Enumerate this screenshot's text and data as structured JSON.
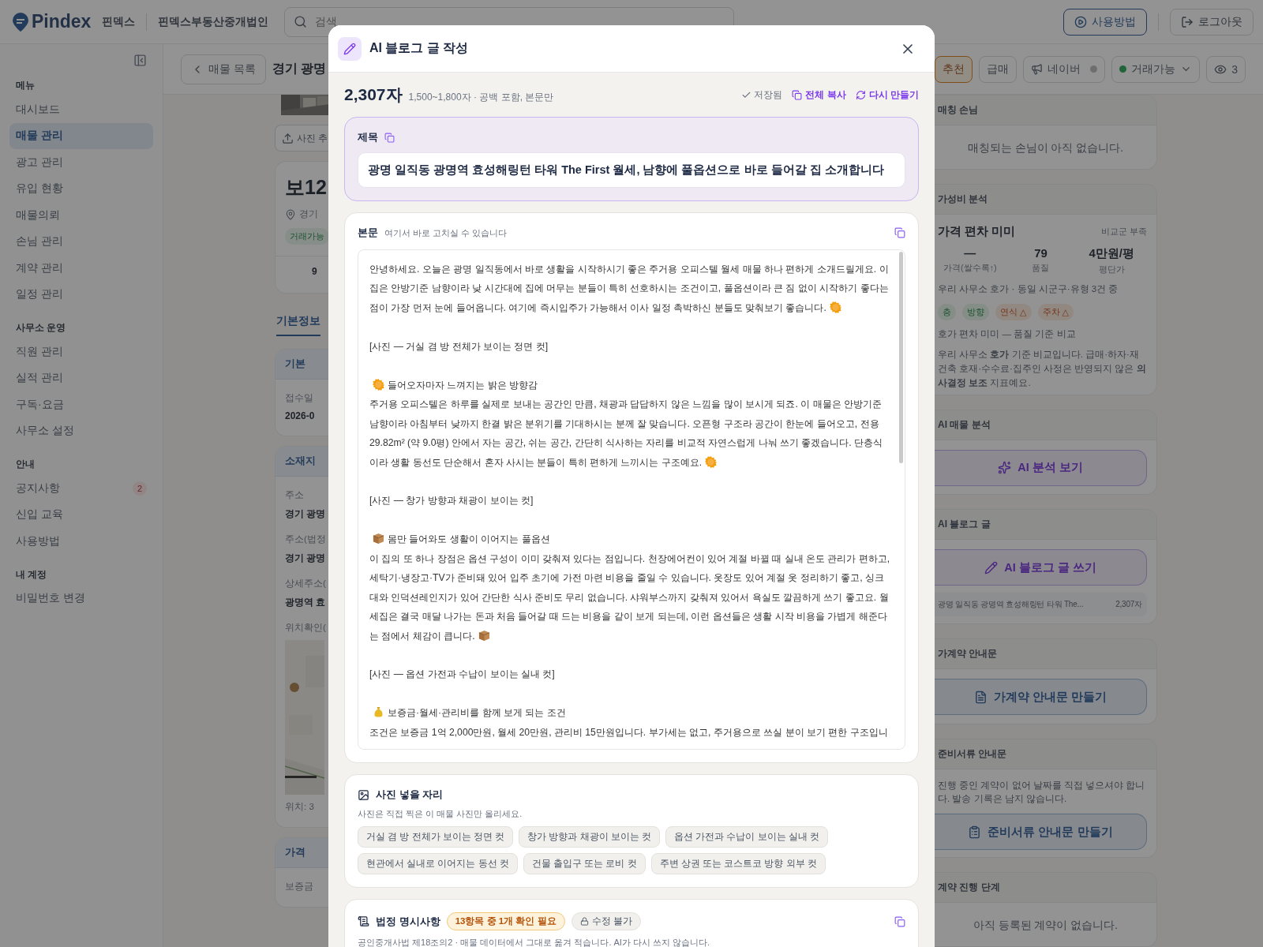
{
  "header": {
    "logo": "Pindex",
    "brand": "핀덱스",
    "office": "핀덱스부동산중개법인",
    "search": {
      "placeholder": "검색"
    },
    "buttons": [
      {
        "kind": "guide",
        "label": "사용방법"
      },
      {
        "kind": "logout",
        "label": "로그아웃"
      }
    ]
  },
  "sidebar": {
    "sections": [
      {
        "title": "메뉴",
        "items": [
          {
            "label": "대시보드",
            "selected": false
          },
          {
            "label": "매물 관리",
            "selected": true
          },
          {
            "label": "광고 관리",
            "selected": false
          },
          {
            "label": "유입 현황",
            "selected": false
          },
          {
            "label": "매물의뢰",
            "selected": false
          },
          {
            "label": "손님 관리",
            "selected": false
          },
          {
            "label": "계약 관리",
            "selected": false
          },
          {
            "label": "일정 관리",
            "selected": false
          }
        ]
      },
      {
        "title": "사무소 운영",
        "items": [
          {
            "label": "직원 관리",
            "selected": false
          },
          {
            "label": "실적 관리",
            "selected": false
          },
          {
            "label": "구독·요금",
            "selected": false
          },
          {
            "label": "사무소 설정",
            "selected": false
          }
        ]
      },
      {
        "title": "안내",
        "items": [
          {
            "label": "공지사항",
            "selected": false,
            "badge": "2"
          },
          {
            "label": "신입 교육",
            "selected": false
          },
          {
            "label": "사용방법",
            "selected": false
          }
        ]
      },
      {
        "title": "내 계정",
        "items": [
          {
            "label": "비밀번호 변경",
            "selected": false
          }
        ]
      }
    ]
  },
  "toolbar": {
    "back": "매물 목록",
    "title": "경기 광명",
    "actions": [
      {
        "kind": "recommend",
        "label": "추천",
        "selected": true
      },
      {
        "kind": "urgent",
        "label": "급매",
        "selected": false
      },
      {
        "kind": "naver",
        "label": "네이버",
        "on": false
      },
      {
        "kind": "status",
        "label": "거래가능"
      },
      {
        "kind": "views",
        "label": "3"
      }
    ]
  },
  "listing": {
    "upload": "사진 추",
    "price": "보12",
    "address": "경기",
    "status": "거래가능",
    "stat": "9",
    "tab": {
      "label": "기본정보",
      "selected": true
    },
    "sections": [
      {
        "title": "기본",
        "fields": [
          {
            "label": "접수일",
            "value": "2026-0"
          }
        ]
      },
      {
        "title": "소재지",
        "fields": [
          {
            "label": "주소",
            "value": "경기 광명"
          },
          {
            "label": "주소(법정",
            "value": "경기 광명"
          },
          {
            "label": "상세주소(",
            "value": "광명역 효"
          },
          {
            "label": "위치확인(",
            "kind": "map",
            "caption": "위치: 3"
          }
        ]
      },
      {
        "title": "가격",
        "fields": [
          {
            "label": "보증금"
          }
        ]
      }
    ]
  },
  "side_panels": [
    {
      "kind": "empty",
      "title": "매칭 손님",
      "message": "매칭되는 손님이 아직 없습니다."
    },
    {
      "kind": "value",
      "title": "가성비 분석",
      "headline": "가격 편차 미미",
      "note": "비교군 부족",
      "stats": [
        {
          "value": "—",
          "label": "가격(쌀수록↑)"
        },
        {
          "value": "79",
          "label": "품질"
        },
        {
          "value": "4만원/평",
          "label": "평단가"
        }
      ],
      "basis": "우리 사무소 호가 · 동일 시군구·유형 3건 중",
      "tags": [
        {
          "label": "층",
          "kind": "good"
        },
        {
          "label": "방향",
          "kind": "good"
        },
        {
          "label": "연식 △",
          "kind": "caution"
        },
        {
          "label": "주차 △",
          "kind": "caution"
        }
      ],
      "summary": "호가 편차 미미 — 품질 기준 비교",
      "disclaimer": "우리 사무소 **호가** 기준 비교입니다. 급매·하자·재건축 호재·수수료·집주인 사정은 반영되지 않은 **의사결정 보조** 지표예요."
    },
    {
      "kind": "ai",
      "title": "AI 매물 분석",
      "button": "AI 분석 보기"
    },
    {
      "kind": "ai",
      "title": "AI 블로그 글",
      "button": "AI 블로그 글 쓰기",
      "draft": {
        "title": "광명 일직동 광명역 효성해링턴 타워 The...",
        "count": "2,307자"
      }
    },
    {
      "kind": "document",
      "title": "가계약 안내문",
      "button": "가계약 안내문 만들기"
    },
    {
      "kind": "document",
      "title": "준비서류 안내문",
      "text": "진행 중인 계약이 없어 날짜를 직접 넣으셔야 합니다. 발송 기록은 남지 않습니다.",
      "button": "준비서류 안내문 만들기"
    },
    {
      "kind": "empty",
      "title": "계약 진행 단계",
      "message": "아직 등록된 계약이 없습니다."
    }
  ],
  "modal": {
    "title": "AI 블로그 글 작성",
    "count": "2,307자",
    "count_hint": "1,500~1,800자 · 공백 포함, 본문만",
    "saved": "저장됨",
    "copy_all": "전체 복사",
    "regenerate": "다시 만들기",
    "post_title": {
      "label": "제목",
      "value": "광명 일직동 광명역 효성해링턴 타워 The First 월세, 남향에 풀옵션으로 바로 들어갈 집 소개합니다"
    },
    "body": {
      "label": "본문",
      "hint": "여기서 바로 고치실 수 있습니다",
      "blocks": [
        {
          "kind": "paragraph",
          "text": "안녕하세요. 오늘은 광명 일직동에서 바로 생활을 시작하시기 좋은 주거용 오피스텔 월세 매물 하나 편하게 소개드릴게요. 이 집은 안방기준 남향이라 낮 시간대에 집에 머무는 분들이 특히 선호하시는 조건이고, 풀옵션이라 큰 짐 없이 시작하기 좋다는 점이 가장 먼저 눈에 들어옵니다. 여기에 즉시입주가 가능해서 이사 일정 촉박하신 분들도 맞춰보기 좋습니다."
        },
        {
          "text": "[사진 — 거실 겸 방 전체가 보이는 정면 컷]"
        },
        {
          "kind": "section",
          "heading": "들어오자마자 느껴지는 밝은 방향감",
          "text": "주거용 오피스텔은 하루를 실제로 보내는 공간인 만큼, 채광과 답답하지 않은 느낌을 많이 보시게 되죠. 이 매물은 안방기준 남향이라 아침부터 낮까지 한결 밝은 분위기를 기대하시는 분께 잘 맞습니다. 오픈형 구조라 공간이 한눈에 들어오고, 전용 29.82m² (약 9.0평) 안에서 자는 공간, 쉬는 공간, 간단히 식사하는 자리를 비교적 자연스럽게 나눠 쓰기 좋겠습니다. 단층식이라 생활 동선도 단순해서 혼자 사시는 분들이 특히 편하게 느끼시는 구조예요."
        },
        {
          "text": "[사진 — 창가 방향과 채광이 보이는 컷]"
        },
        {
          "kind": "section",
          "heading": "몸만 들어와도 생활이 이어지는 풀옵션",
          "text": "이 집의 또 하나 장점은 옵션 구성이 이미 갖춰져 있다는 점입니다. 천장에어컨이 있어 계절 바뀔 때 실내 온도 관리가 편하고, 세탁기·냉장고·TV가 준비돼 있어 입주 초기에 가전 마련 비용을 줄일 수 있습니다. 옷장도 있어 계절 옷 정리하기 좋고, 싱크대와 인덕션레인지가 있어 간단한 식사 준비도 무리 없습니다. 샤워부스까지 갖춰져 있어서 욕실도 깔끔하게 쓰기 좋고요. 월세집은 결국 매달 나가는 돈과 처음 들어갈 때 드는 비용을 같이 보게 되는데, 이런 옵션들은 생활 시작 비용을 가볍게 해준다는 점에서 체감이 큽니다."
        },
        {
          "text": "[사진 — 옵션 가전과 수납이 보이는 실내 컷]"
        },
        {
          "kind": "section",
          "heading": "보증금·월세·관리비를 함께 보게 되는 조건",
          "text": "조건은 보증금 1억 2,000만원, 월세 20만원, 관리비 15만원입니다. 부가세는 없고, 주거용으로 쓰실 분이 보기 편한 구조입니"
        }
      ]
    },
    "photos": {
      "title": "사진 넣을 자리",
      "hint": "사진은 직접 찍은 이 매물 사진만 올리세요.",
      "chips": [
        "거실 겸 방 전체가 보이는 정면 컷",
        "창가 방향과 채광이 보이는 컷",
        "옵션 가전과 수납이 보이는 실내 컷",
        "현관에서 실내로 이어지는 동선 컷",
        "건물 출입구 또는 로비 컷",
        "주변 상권 또는 코스트코 방향 외부 컷"
      ]
    },
    "legal": {
      "title": "법정 명시사항",
      "warning": "13항목 중 1개 확인 필요",
      "locked": "수정 불가",
      "hint": "공인중개사법 제18조의2 · 매물 데이터에서 그대로 옮겨 적습니다. AI가 다시 쓰지 않습니다."
    }
  }
}
